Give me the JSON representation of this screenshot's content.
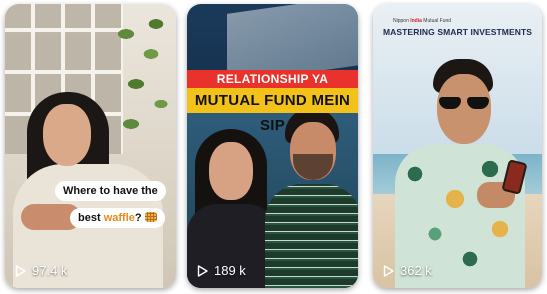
{
  "reels": [
    {
      "caption_line1": "Where to have the",
      "caption_line2_prefix": "best ",
      "caption_line2_highlight": "waffle",
      "caption_line2_suffix": "?",
      "views": "97.4 k",
      "icon": "waffle-icon"
    },
    {
      "title_line1": "RELATIONSHIP YA",
      "title_line2": "MUTUAL FUND MEIN SIP",
      "views": "189 k"
    },
    {
      "logo_text_prefix": "Nippon ",
      "logo_text_brand": "India",
      "logo_text_suffix": " Mutual Fund",
      "title": "MASTERING SMART INVESTMENTS",
      "views": "362 k"
    }
  ],
  "colors": {
    "red_banner": "#e8322b",
    "yellow_banner": "#f2c21a",
    "waffle_highlight": "#e58a1f",
    "title_navy": "#1c2a52"
  },
  "icons": {
    "views": "play-icon"
  }
}
